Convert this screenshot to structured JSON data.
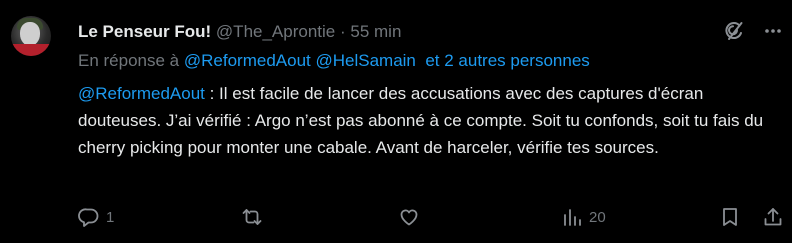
{
  "author": {
    "name": "Le Penseur Fou!",
    "handle": "@The_Aprontie",
    "separator": "·",
    "time": "55 min"
  },
  "reply_to": {
    "prefix": "En réponse à",
    "mentions": [
      "@ReformedAout",
      "@HelSamain"
    ],
    "suffix": "et 2 autres personnes"
  },
  "post": {
    "mention": "@ReformedAout",
    "text": " : Il est facile de lancer des accusations avec des captures d'écran douteuses. J’ai vérifié : Argo n’est pas abonné à ce compte. Soit tu confonds, soit tu fais du cherry picking pour monter une cabale. Avant de harceler, vérifie tes sources."
  },
  "actions": {
    "reply_count": "1",
    "repost_count": "",
    "like_count": "",
    "views_count": "20"
  },
  "icons": [
    "grok-icon",
    "more-icon",
    "reply-icon",
    "repost-icon",
    "like-icon",
    "views-icon",
    "bookmark-icon",
    "share-icon"
  ],
  "colors": {
    "background": "#000000",
    "text": "#e7e9ea",
    "muted": "#71767b",
    "link": "#1d9bf0"
  }
}
